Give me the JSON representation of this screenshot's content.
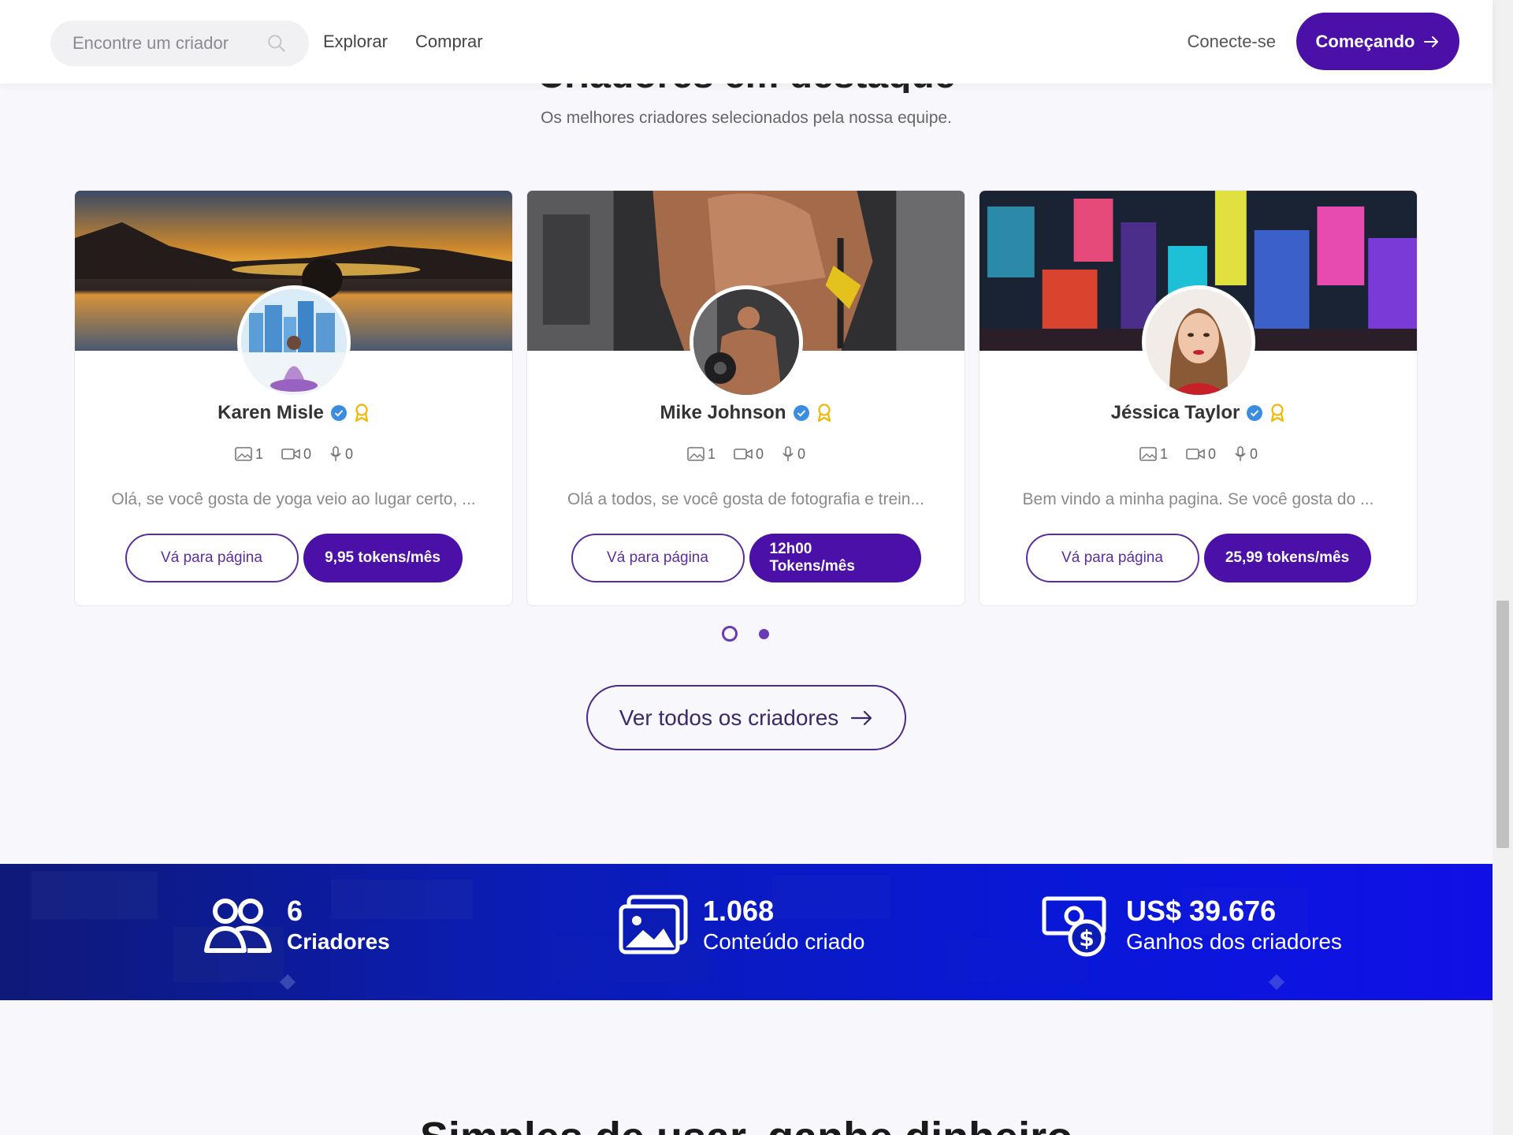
{
  "header": {
    "search_placeholder": "Encontre um criador",
    "nav": [
      "Explorar",
      "Comprar"
    ],
    "login": "Conecte-se",
    "cta": "Começando"
  },
  "featured": {
    "heading": "Criadores em destaque",
    "subtitle": "Os melhores criadores selecionados pela nossa equipe.",
    "cards": [
      {
        "name": "Karen Misle",
        "stats": {
          "images": "1",
          "videos": "0",
          "audio": "0"
        },
        "description": "Olá, se você gosta de yoga veio ao lugar certo, ...",
        "page_button": "Vá para página",
        "price_button": "9,95 tokens/mês"
      },
      {
        "name": "Mike Johnson",
        "stats": {
          "images": "1",
          "videos": "0",
          "audio": "0"
        },
        "description": "Olá a todos, se você gosta de fotografia e trein...",
        "page_button": "Vá para página",
        "price_button": "12h00 Tokens/mês"
      },
      {
        "name": "Jéssica Taylor",
        "stats": {
          "images": "1",
          "videos": "0",
          "audio": "0"
        },
        "description": "Bem vindo a minha pagina. Se você gosta do ...",
        "page_button": "Vá para página",
        "price_button": "25,99 tokens/mês"
      }
    ],
    "carousel_pages": 2,
    "carousel_active": 1,
    "view_all": "Ver todos os criadores"
  },
  "stats_band": [
    {
      "value": "6",
      "label": "Criadores",
      "icon": "users-icon"
    },
    {
      "value": "1.068",
      "label": "Conteúdo criado",
      "icon": "image-icon"
    },
    {
      "value": "US$ 39.676",
      "label": "Ganhos dos criadores",
      "icon": "money-icon"
    }
  ],
  "bottom_heading": "Simples de usar, ganhe dinheiro",
  "colors": {
    "primary": "#4b10a8",
    "verified": "#3b8de0",
    "award": "#f2b705",
    "band": "#0b1cb5"
  }
}
